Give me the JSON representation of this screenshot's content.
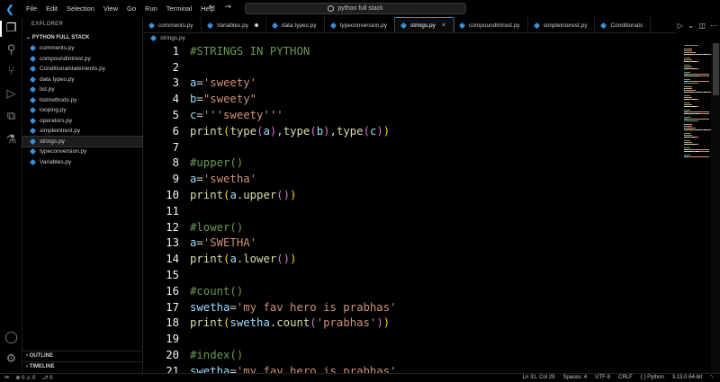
{
  "menu": [
    "File",
    "Edit",
    "Selection",
    "View",
    "Go",
    "Run",
    "Terminal",
    "Help"
  ],
  "command_center": {
    "text": "python full stack"
  },
  "sidebar": {
    "title": "EXPLORER",
    "folder": "PYTHON FULL STACK",
    "files": [
      "comments.py",
      "compoundintrest.py",
      "Conditionalstatements.py",
      "data types.py",
      "list.py",
      "listmethods.py",
      "looping.py",
      "operators.py",
      "simpleintrest.py",
      "strings.py",
      "typeconversion.py",
      "Variables.py"
    ],
    "active_file": "strings.py",
    "outline": "OUTLINE",
    "timeline": "TIMELINE"
  },
  "tabs": [
    {
      "label": "comments.py",
      "state": ""
    },
    {
      "label": "Variables.py",
      "state": "dirty"
    },
    {
      "label": "data types.py",
      "state": ""
    },
    {
      "label": "typeconversion.py",
      "state": ""
    },
    {
      "label": "strings.py",
      "state": "active"
    },
    {
      "label": "compoundintrest.py",
      "state": ""
    },
    {
      "label": "simpleinterest.py",
      "state": ""
    },
    {
      "label": "Conditionals",
      "state": ""
    }
  ],
  "breadcrumb": "strings.py",
  "code_lines": [
    {
      "n": "1",
      "tokens": [
        [
          "c",
          "#STRINGS IN PYTHON"
        ]
      ]
    },
    {
      "n": "2",
      "tokens": []
    },
    {
      "n": "3",
      "tokens": [
        [
          "v",
          "a"
        ],
        [
          "o",
          "="
        ],
        [
          "s",
          "'sweety'"
        ]
      ]
    },
    {
      "n": "4",
      "tokens": [
        [
          "v",
          "b"
        ],
        [
          "o",
          "="
        ],
        [
          "s",
          "\"sweety\""
        ]
      ]
    },
    {
      "n": "5",
      "tokens": [
        [
          "v",
          "c"
        ],
        [
          "o",
          "="
        ],
        [
          "s",
          "'''sweety'''"
        ]
      ]
    },
    {
      "n": "6",
      "tokens": [
        [
          "f",
          "print"
        ],
        [
          "p1",
          "("
        ],
        [
          "f",
          "type"
        ],
        [
          "p2",
          "("
        ],
        [
          "v",
          "a"
        ],
        [
          "p2",
          ")"
        ],
        [
          "o",
          ","
        ],
        [
          "f",
          "type"
        ],
        [
          "p2",
          "("
        ],
        [
          "v",
          "b"
        ],
        [
          "p2",
          ")"
        ],
        [
          "o",
          ","
        ],
        [
          "f",
          "type"
        ],
        [
          "p2",
          "("
        ],
        [
          "v",
          "c"
        ],
        [
          "p2",
          ")"
        ],
        [
          "p1",
          ")"
        ]
      ]
    },
    {
      "n": "7",
      "tokens": []
    },
    {
      "n": "8",
      "tokens": [
        [
          "c",
          "#upper()"
        ]
      ]
    },
    {
      "n": "9",
      "tokens": [
        [
          "v",
          "a"
        ],
        [
          "o",
          "="
        ],
        [
          "s",
          "'swetha'"
        ]
      ]
    },
    {
      "n": "10",
      "tokens": [
        [
          "f",
          "print"
        ],
        [
          "p1",
          "("
        ],
        [
          "v",
          "a"
        ],
        [
          "o",
          "."
        ],
        [
          "f",
          "upper"
        ],
        [
          "p2",
          "()"
        ],
        [
          "p1",
          ")"
        ]
      ]
    },
    {
      "n": "11",
      "tokens": []
    },
    {
      "n": "12",
      "tokens": [
        [
          "c",
          "#lower()"
        ]
      ]
    },
    {
      "n": "13",
      "tokens": [
        [
          "v",
          "a"
        ],
        [
          "o",
          "="
        ],
        [
          "s",
          "'SWETHA'"
        ]
      ]
    },
    {
      "n": "14",
      "tokens": [
        [
          "f",
          "print"
        ],
        [
          "p1",
          "("
        ],
        [
          "v",
          "a"
        ],
        [
          "o",
          "."
        ],
        [
          "f",
          "lower"
        ],
        [
          "p2",
          "()"
        ],
        [
          "p1",
          ")"
        ]
      ]
    },
    {
      "n": "15",
      "tokens": []
    },
    {
      "n": "16",
      "tokens": [
        [
          "c",
          "#count()"
        ]
      ]
    },
    {
      "n": "17",
      "tokens": [
        [
          "v",
          "swetha"
        ],
        [
          "o",
          "="
        ],
        [
          "s",
          "'my fav hero is prabhas'"
        ]
      ]
    },
    {
      "n": "18",
      "tokens": [
        [
          "f",
          "print"
        ],
        [
          "p1",
          "("
        ],
        [
          "v",
          "swetha"
        ],
        [
          "o",
          "."
        ],
        [
          "f",
          "count"
        ],
        [
          "p2",
          "("
        ],
        [
          "s",
          "'prabhas'"
        ],
        [
          "p2",
          ")"
        ],
        [
          "p1",
          ")"
        ]
      ]
    },
    {
      "n": "19",
      "tokens": []
    },
    {
      "n": "20",
      "tokens": [
        [
          "c",
          "#index()"
        ]
      ]
    },
    {
      "n": "21",
      "tokens": [
        [
          "v",
          "swetha"
        ],
        [
          "o",
          "="
        ],
        [
          "s",
          "'my fav hero is prabhas'"
        ]
      ]
    }
  ],
  "status": {
    "errors": "0",
    "warnings": "0",
    "ports": "0",
    "position": "Ln 31, Col 29",
    "spaces": "Spaces: 4",
    "encoding": "UTF-8",
    "eol": "CRLF",
    "language": "Python",
    "interpreter": "3.13.0 64-bit"
  },
  "colors": {
    "accent": "#3b8fd6",
    "comment": "#6a9955",
    "string": "#ce9178",
    "variable": "#9cdcfe",
    "function": "#dcdcaa"
  }
}
